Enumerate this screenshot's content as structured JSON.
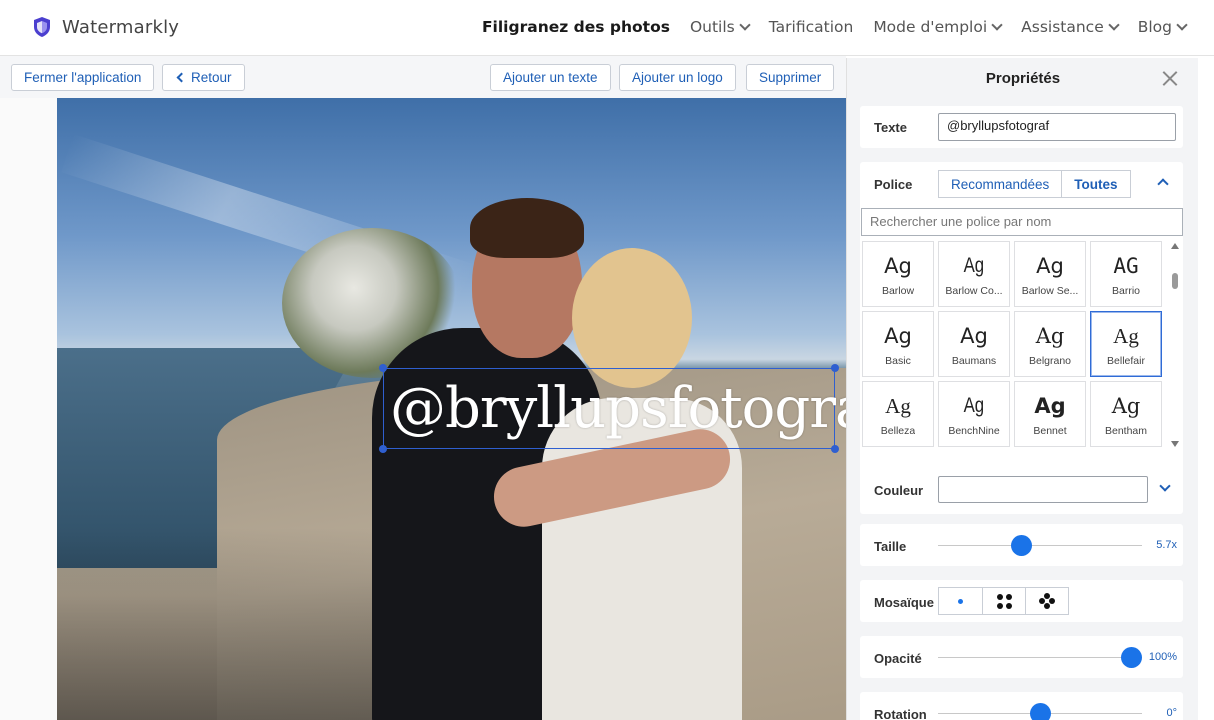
{
  "brand": {
    "name": "Watermarkly"
  },
  "nav": [
    {
      "label": "Filigranez des photos",
      "active": true,
      "dropdown": false
    },
    {
      "label": "Outils",
      "active": false,
      "dropdown": true
    },
    {
      "label": "Tarification",
      "active": false,
      "dropdown": false
    },
    {
      "label": "Mode d'emploi",
      "active": false,
      "dropdown": true
    },
    {
      "label": "Assistance",
      "active": false,
      "dropdown": true
    },
    {
      "label": "Blog",
      "active": false,
      "dropdown": true
    }
  ],
  "toolbar": {
    "close_app": "Fermer l'application",
    "back": "Retour",
    "add_text": "Ajouter un texte",
    "add_logo": "Ajouter un logo",
    "delete": "Supprimer"
  },
  "watermark": {
    "text": "@bryllupsfotograf"
  },
  "panel": {
    "title": "Propriétés",
    "text_label": "Texte",
    "text_value": "@bryllupsfotograf",
    "font_label": "Police",
    "font_tabs": {
      "recommended": "Recommandées",
      "all": "Toutes"
    },
    "font_search_placeholder": "Rechercher une police par nom",
    "fonts": [
      {
        "sample": "Ag",
        "name": "Barlow",
        "selected": false
      },
      {
        "sample": "Ag",
        "name": "Barlow Co...",
        "selected": false
      },
      {
        "sample": "Ag",
        "name": "Barlow Se...",
        "selected": false
      },
      {
        "sample": "AG",
        "name": "Barrio",
        "selected": false
      },
      {
        "sample": "Ag",
        "name": "Basic",
        "selected": false
      },
      {
        "sample": "Ag",
        "name": "Baumans",
        "selected": false
      },
      {
        "sample": "Ag",
        "name": "Belgrano",
        "selected": false
      },
      {
        "sample": "Ag",
        "name": "Bellefair",
        "selected": true
      },
      {
        "sample": "Ag",
        "name": "Belleza",
        "selected": false
      },
      {
        "sample": "Ag",
        "name": "BenchNine",
        "selected": false
      },
      {
        "sample": "Ag",
        "name": "Bennet",
        "selected": false
      },
      {
        "sample": "Ag",
        "name": "Bentham",
        "selected": false
      }
    ],
    "color_label": "Couleur",
    "size_label": "Taille",
    "size_value": "5.7x",
    "size_fraction": 0.4,
    "tiling_label": "Mosaïque",
    "opacity_label": "Opacité",
    "opacity_value": "100%",
    "opacity_fraction": 1.0,
    "rotation_label": "Rotation",
    "rotation_value": "0°",
    "rotation_fraction": 0.5
  },
  "colors": {
    "accent": "#1a73e8",
    "link": "#1f5fb6",
    "selection": "#2f5fd0"
  }
}
